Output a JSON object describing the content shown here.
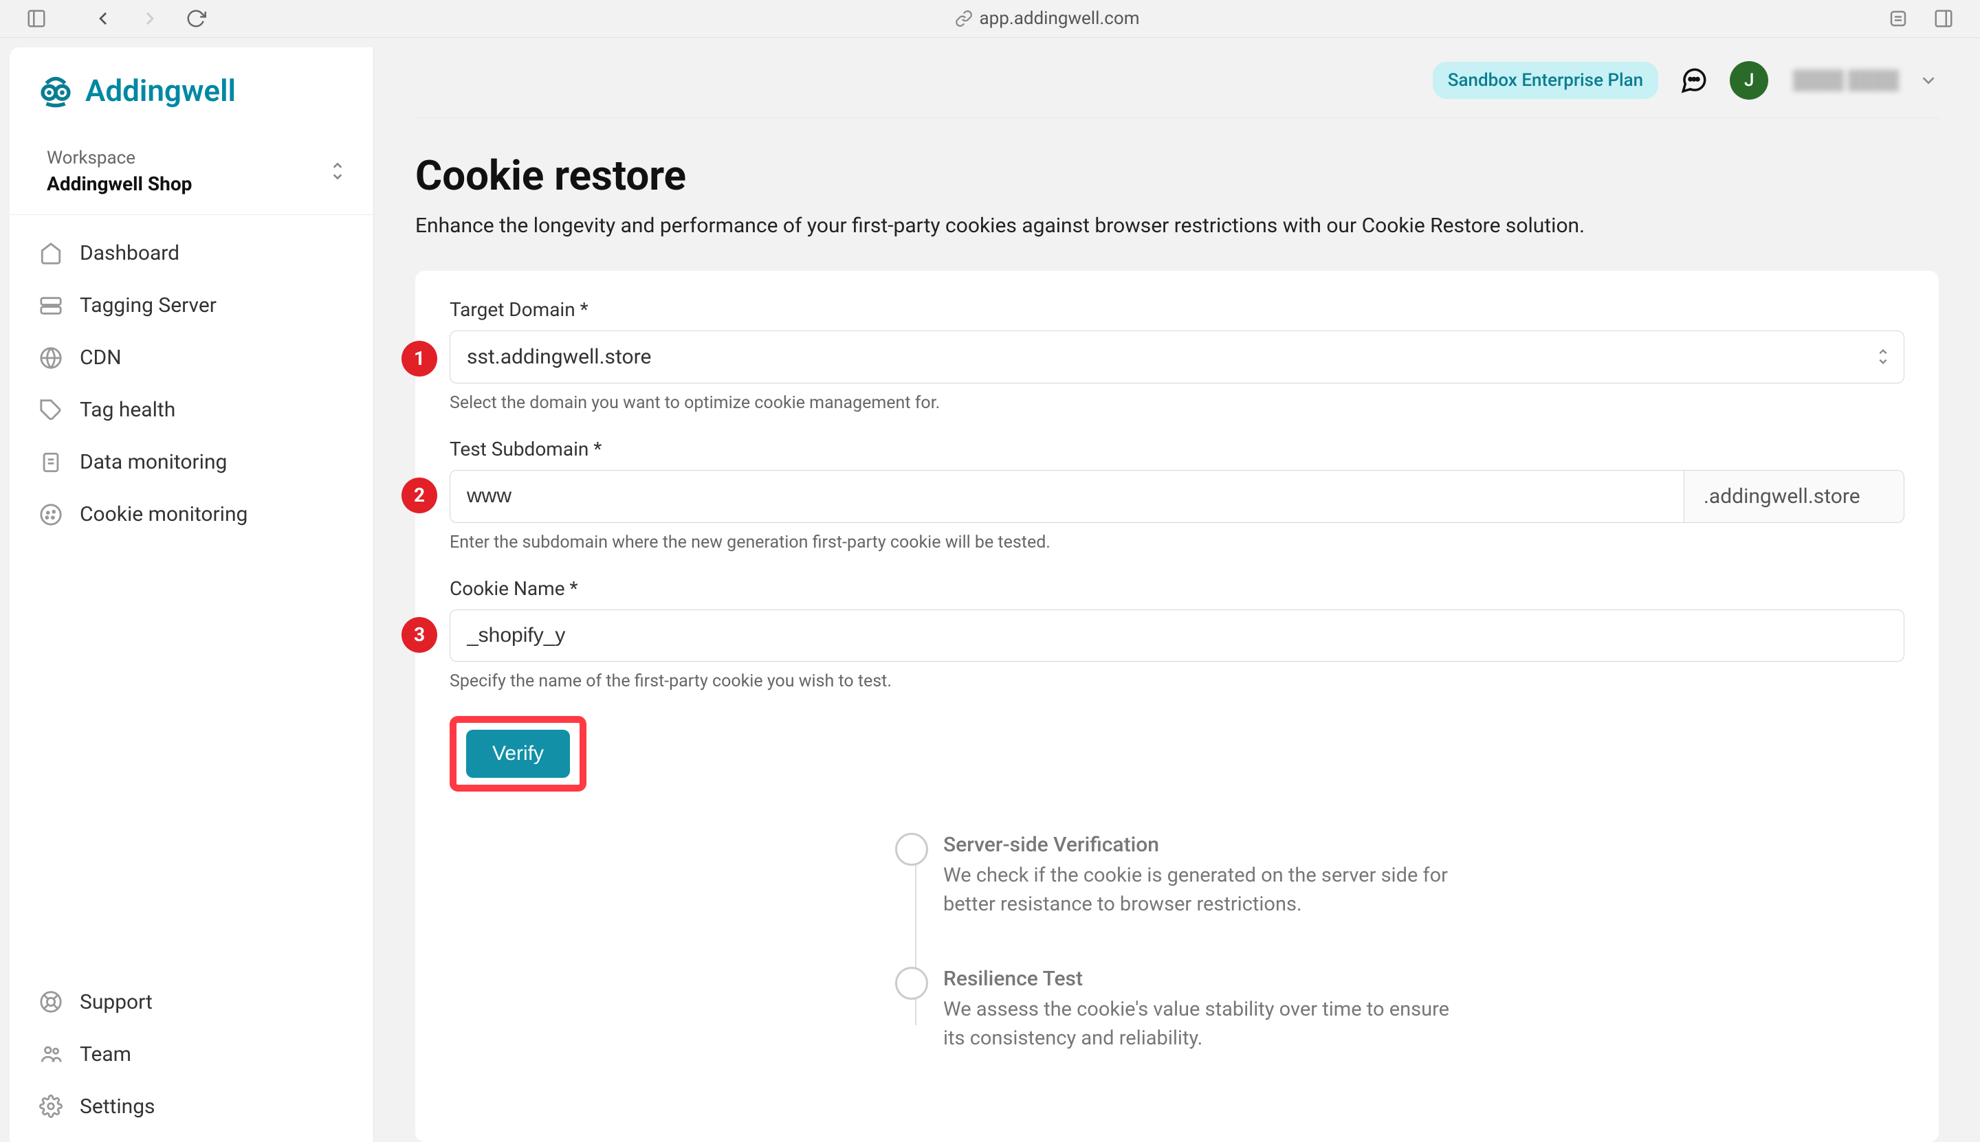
{
  "browser": {
    "url": "app.addingwell.com"
  },
  "brand": {
    "name": "Addingwell"
  },
  "workspace": {
    "label": "Workspace",
    "name": "Addingwell Shop"
  },
  "sidebar": {
    "items": [
      {
        "icon": "home",
        "label": "Dashboard"
      },
      {
        "icon": "server",
        "label": "Tagging Server"
      },
      {
        "icon": "globe",
        "label": "CDN"
      },
      {
        "icon": "tag",
        "label": "Tag health"
      },
      {
        "icon": "clipboard",
        "label": "Data monitoring"
      },
      {
        "icon": "cookie",
        "label": "Cookie monitoring"
      }
    ],
    "bottom": [
      {
        "icon": "lifebuoy",
        "label": "Support"
      },
      {
        "icon": "team",
        "label": "Team"
      },
      {
        "icon": "gear",
        "label": "Settings"
      }
    ]
  },
  "topbar": {
    "plan": "Sandbox Enterprise Plan",
    "avatar_initial": "J",
    "username_obscured": "████ ████"
  },
  "page": {
    "title": "Cookie restore",
    "subtitle": "Enhance the longevity and performance of your first-party cookies against browser restrictions with our Cookie Restore solution."
  },
  "form": {
    "fields": [
      {
        "badge": "1",
        "label": "Target Domain *",
        "value": "sst.addingwell.store",
        "help": "Select the domain you want to optimize cookie management for.",
        "type": "select"
      },
      {
        "badge": "2",
        "label": "Test Subdomain *",
        "value": "www",
        "suffix": ".addingwell.store",
        "help": "Enter the subdomain where the new generation first-party cookie will be tested.",
        "type": "input-suffix"
      },
      {
        "badge": "3",
        "label": "Cookie Name *",
        "value": "_shopify_y",
        "help": "Specify the name of the first-party cookie you wish to test.",
        "type": "input"
      }
    ],
    "verify_label": "Verify"
  },
  "verification_steps": [
    {
      "title": "Server-side Verification",
      "desc": "We check if the cookie is generated on the server side for better resistance to browser restrictions."
    },
    {
      "title": "Resilience Test",
      "desc": "We assess the cookie's value stability over time to ensure its consistency and reliability."
    }
  ]
}
